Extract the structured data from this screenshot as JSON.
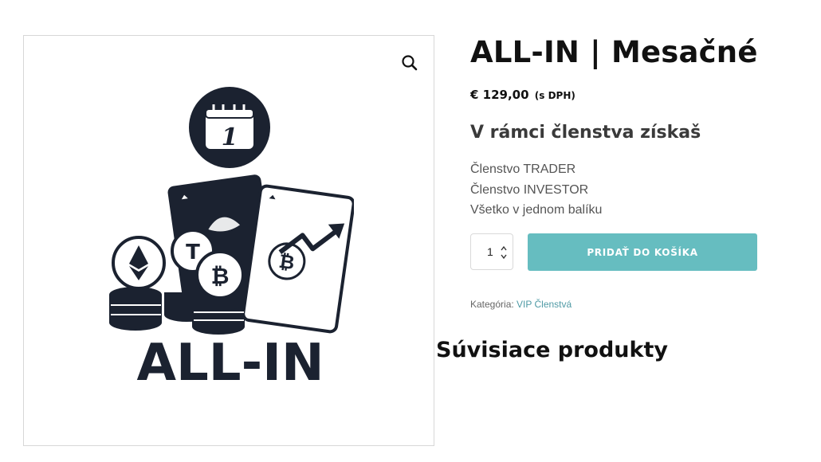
{
  "gallery": {
    "zoom_icon": "magnifier-icon",
    "image_logo_text": "ALL-IN",
    "image_calendar_day": "1"
  },
  "product": {
    "title": "ALL-IN | Mesačné",
    "price": "€ 129,00",
    "price_suffix": "(s DPH)",
    "benefits_heading": "V rámci členstva získaš",
    "benefits": [
      "Členstvo TRADER",
      "Členstvo INVESTOR",
      "Všetko v jednom balíku"
    ],
    "quantity": "1",
    "add_to_cart_label": "PRIDAŤ DO KOŠÍKA",
    "category_label": "Kategória:",
    "category_link": "VIP Členstvá"
  },
  "related": {
    "heading": "Súvisiace produkty"
  },
  "colors": {
    "accent": "#66bdc0",
    "link": "#4f9aa5",
    "logo_dark": "#1b2230"
  }
}
